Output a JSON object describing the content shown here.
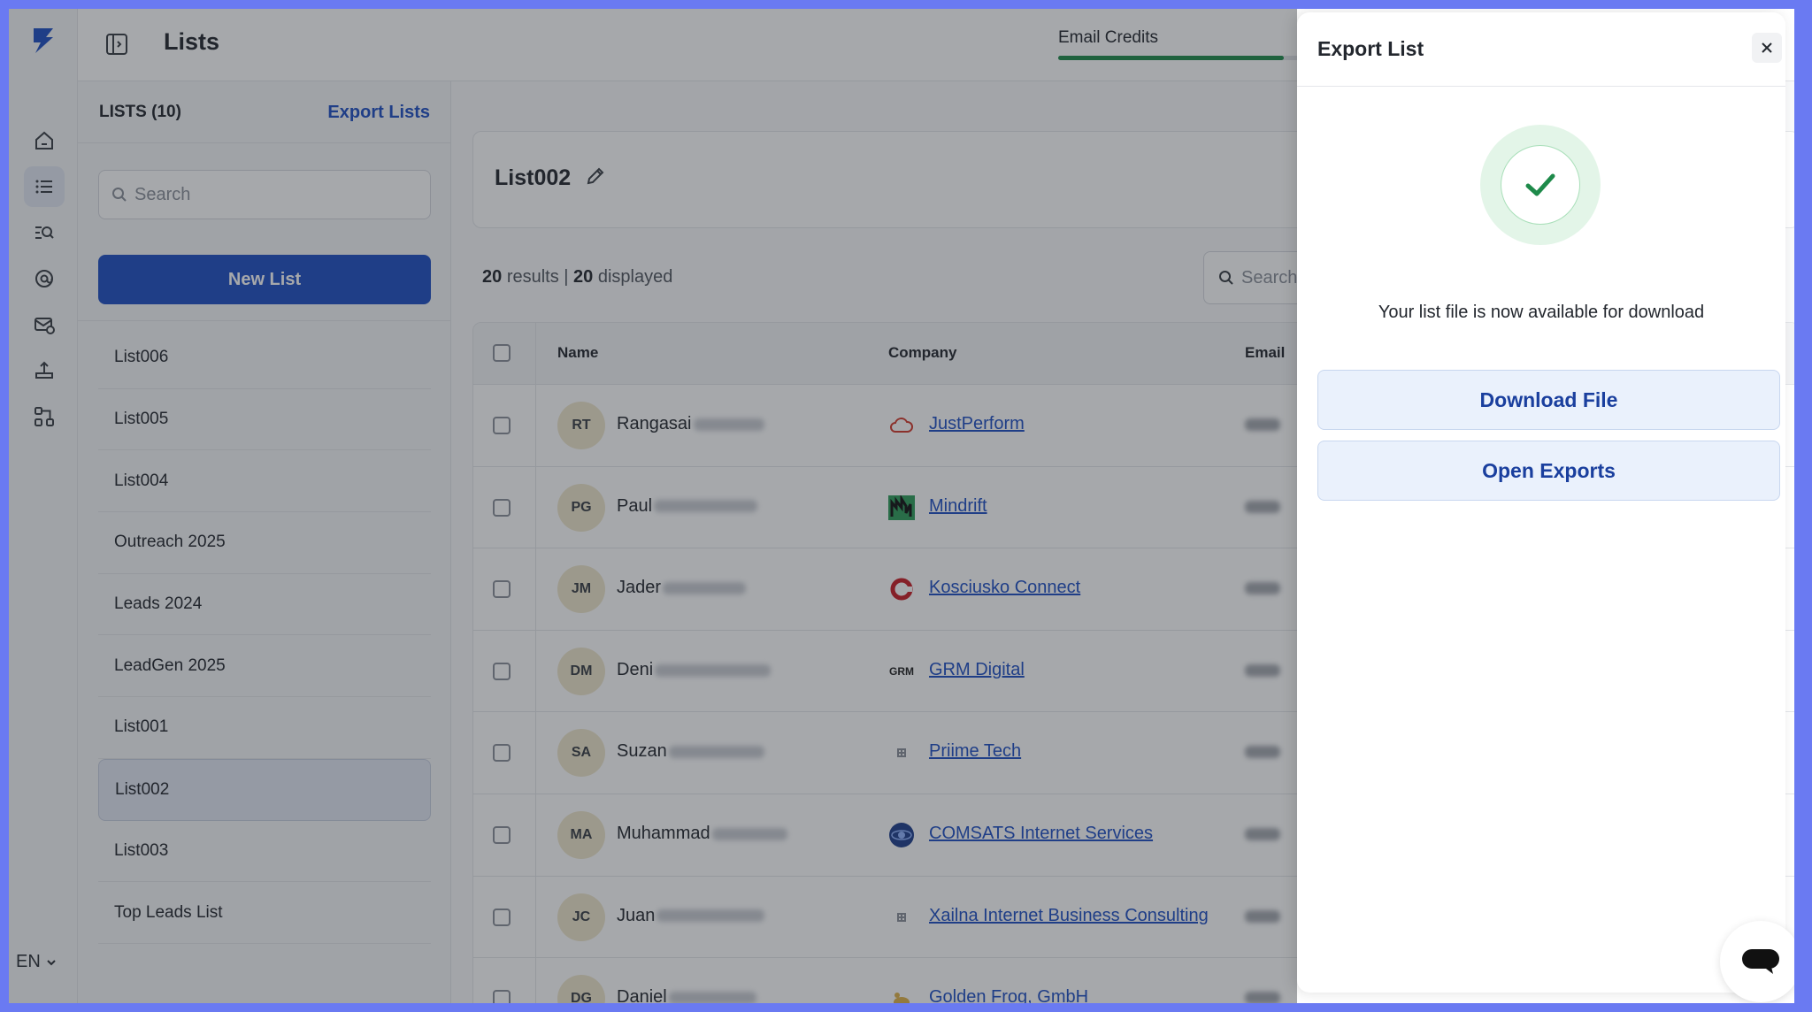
{
  "app": {
    "page_title": "Lists",
    "lang": "EN"
  },
  "credits": {
    "label": "Email Credits",
    "fraction": 0.85,
    "color": "#1e8a4a"
  },
  "sidebar": {
    "lists_count": "LISTS (10)",
    "export_lists": "Export Lists",
    "search_placeholder": "Search",
    "new_list": "New List",
    "items": [
      {
        "label": "List006"
      },
      {
        "label": "List005"
      },
      {
        "label": "List004"
      },
      {
        "label": "Outreach 2025"
      },
      {
        "label": "Leads 2024"
      },
      {
        "label": "LeadGen 2025"
      },
      {
        "label": "List001"
      },
      {
        "label": "List002",
        "selected": true
      },
      {
        "label": "List003"
      },
      {
        "label": "Top Leads List"
      }
    ]
  },
  "main": {
    "list_name": "List002",
    "results_count": "20",
    "results_label": "results",
    "displayed_count": "20",
    "displayed_label": "displayed",
    "search_placeholder": "Search",
    "columns": [
      "Name",
      "Company",
      "Email"
    ],
    "rows": [
      {
        "initials": "RT",
        "first_name": "Rangasai",
        "company": "JustPerform",
        "logo": "cloud-logo-icon"
      },
      {
        "initials": "PG",
        "first_name": "Paul",
        "company": "Mindrift",
        "logo": "mindrift-logo-icon"
      },
      {
        "initials": "JM",
        "first_name": "Jader",
        "company": "Kosciusko Connect",
        "logo": "ring-logo-icon"
      },
      {
        "initials": "DM",
        "first_name": "Deni",
        "company": "GRM Digital",
        "logo": "grm-logo-icon",
        "logo_text": "GRM"
      },
      {
        "initials": "SA",
        "first_name": "Suzan",
        "company": "Priime Tech",
        "logo": "building-logo-icon"
      },
      {
        "initials": "MA",
        "first_name": "Muhammad",
        "company": "COMSATS Internet Services",
        "logo": "globe-logo-icon"
      },
      {
        "initials": "JC",
        "first_name": "Juan",
        "company": "Xailna Internet Business Consulting",
        "logo": "building-logo-icon"
      },
      {
        "initials": "DG",
        "first_name": "Daniel",
        "company": "Golden Frog, GmbH",
        "logo": "frog-logo-icon"
      }
    ]
  },
  "drawer": {
    "title": "Export List",
    "message": "Your list file is now available for download",
    "download_label": "Download File",
    "open_exports_label": "Open Exports"
  },
  "colors": {
    "brand": "#1f4fc4",
    "success": "#1e8a4a",
    "frame": "#6a7af2"
  }
}
